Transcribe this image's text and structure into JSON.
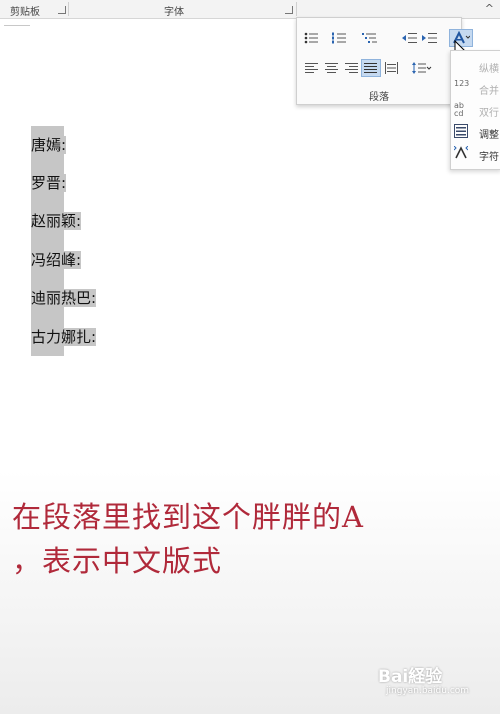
{
  "ribbon": {
    "clipboard_label": "剪贴板",
    "font_label": "字体",
    "paragraph_label": "段落",
    "collapse_glyph": "^"
  },
  "dropdown": {
    "items": [
      {
        "label": "纵横",
        "enabled": false
      },
      {
        "label": "合并",
        "enabled": false
      },
      {
        "label": "双行",
        "enabled": false
      },
      {
        "label": "调整",
        "enabled": true
      },
      {
        "label": "字符",
        "enabled": true
      }
    ],
    "icon_text_1": "123",
    "icon_text_2a": "ab",
    "icon_text_2b": "cd"
  },
  "document": {
    "names": [
      "唐嫣:",
      "罗晋:",
      "赵丽颖:",
      "冯绍峰:",
      "迪丽热巴:",
      "古力娜扎:"
    ]
  },
  "caption": {
    "line1": "在段落里找到这个胖胖的A",
    "line2": "，表示中文版式",
    "color": "#b0293a"
  },
  "watermark": {
    "brand": "Bai経验",
    "url": "jingyan.baidu.com"
  }
}
